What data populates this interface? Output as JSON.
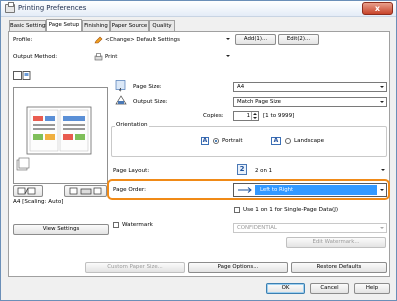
{
  "window": {
    "title": "Printing Preferences",
    "close_glyph": "x"
  },
  "tabs": [
    {
      "label": "Basic Settings"
    },
    {
      "label": "Page Setup"
    },
    {
      "label": "Finishing"
    },
    {
      "label": "Paper Source"
    },
    {
      "label": "Quality"
    }
  ],
  "profile": {
    "label": "Profile:",
    "value": "<Change> Default Settings",
    "add_label": "Add(1)...",
    "edit_label": "Edit(2)..."
  },
  "output_method": {
    "label": "Output Method:",
    "value": "Print"
  },
  "page_size": {
    "label": "Page Size:",
    "value": "A4"
  },
  "output_size": {
    "label": "Output Size:",
    "value": "Match Page Size"
  },
  "copies": {
    "label": "Copies:",
    "value": "1",
    "range": "[1 to 9999]"
  },
  "orientation": {
    "label": "Orientation",
    "portrait": "Portrait",
    "landscape": "Landscape",
    "selected": "portrait",
    "portrait_glyph": "A",
    "landscape_glyph": "A"
  },
  "page_layout": {
    "label": "Page Layout:",
    "value": "2 on 1",
    "badge": "2"
  },
  "page_order": {
    "label": "Page Order:",
    "value": "Left to Right",
    "highlight_color": "#f08a17",
    "selected_bg": "#3399ff"
  },
  "single_page_data": {
    "label": "Use 1 on 1 for Single-Page Data(J)",
    "checked": false
  },
  "watermark": {
    "label": "Watermark",
    "checked": false,
    "value": "CONFIDENTIAL",
    "edit_label": "Edit Watermark..."
  },
  "preview": {
    "scaling": "A4 [Scaling: Auto]",
    "view_settings_label": "View Settings"
  },
  "bottom_buttons": {
    "custom_paper": "Custom Paper Size...",
    "page_options": "Page Options...",
    "restore": "Restore Defaults"
  },
  "footer": {
    "ok": "OK",
    "cancel": "Cancel",
    "help": "Help"
  }
}
